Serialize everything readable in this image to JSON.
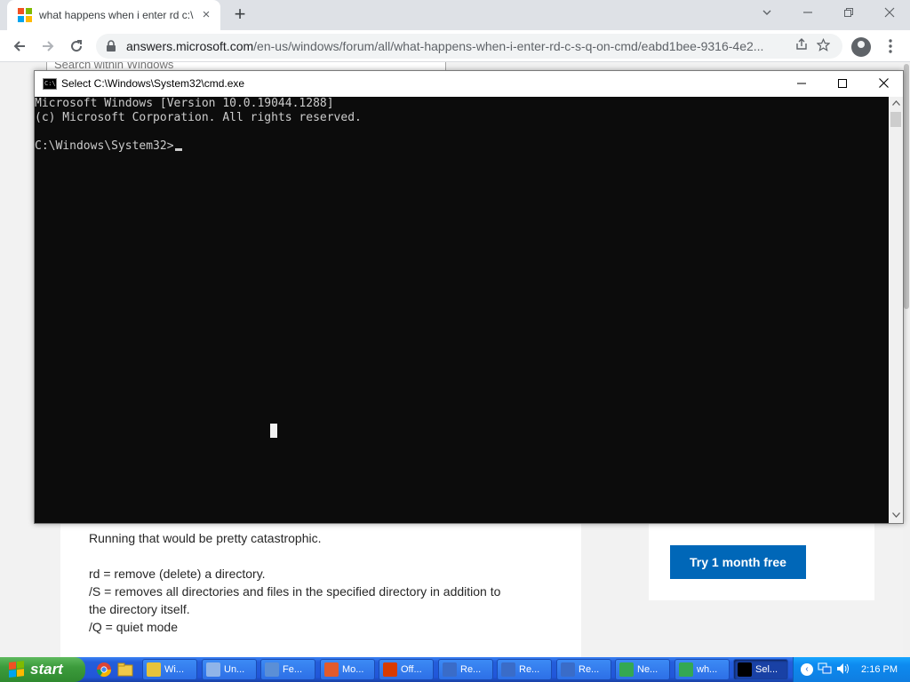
{
  "browser": {
    "tab_title": "what happens when i enter rd c:\\",
    "url_host": "answers.microsoft.com",
    "url_path": "/en-us/windows/forum/all/what-happens-when-i-enter-rd-c-s-q-on-cmd/eabd1bee-9316-4e2...",
    "new_tab_symbol": "+",
    "close_symbol": "×"
  },
  "page": {
    "search_placeholder": "Search within Windows",
    "paragraphs": [
      "Running that would be pretty catastrophic.",
      "",
      "rd = remove (delete) a directory.",
      "/S = removes all directories and files in the specified directory in addition to",
      "the directory itself.",
      "/Q = quiet mode"
    ],
    "try_button": "Try 1 month free"
  },
  "cmd": {
    "title": "Select C:\\Windows\\System32\\cmd.exe",
    "icon_text": "C:\\",
    "lines": [
      "Microsoft Windows [Version 10.0.19044.1288]",
      "(c) Microsoft Corporation. All rights reserved.",
      "",
      "C:\\Windows\\System32>"
    ]
  },
  "taskbar": {
    "start_label": "start",
    "buttons": [
      {
        "label": "Wi...",
        "color": "#e8c33a"
      },
      {
        "label": "Un...",
        "color": "#8fb4e8"
      },
      {
        "label": "Fe...",
        "color": "#5b8fd6"
      },
      {
        "label": "Mo...",
        "color": "#e25b2b"
      },
      {
        "label": "Off...",
        "color": "#d83b01"
      },
      {
        "label": "Re...",
        "color": "#3a6cc8"
      },
      {
        "label": "Re...",
        "color": "#3a6cc8"
      },
      {
        "label": "Re...",
        "color": "#3a6cc8"
      },
      {
        "label": "Ne...",
        "color": "#34a853"
      },
      {
        "label": "wh...",
        "color": "#34a853"
      },
      {
        "label": "Sel...",
        "color": "#000000",
        "active": true
      }
    ],
    "clock": "2:16 PM"
  },
  "colors": {
    "accent_blue": "#0067b8",
    "console_bg": "#0c0c0c",
    "console_fg": "#cccccc",
    "ms_red": "#f25022",
    "ms_green": "#7fba00",
    "ms_blue": "#00a4ef",
    "ms_yellow": "#ffb900"
  }
}
